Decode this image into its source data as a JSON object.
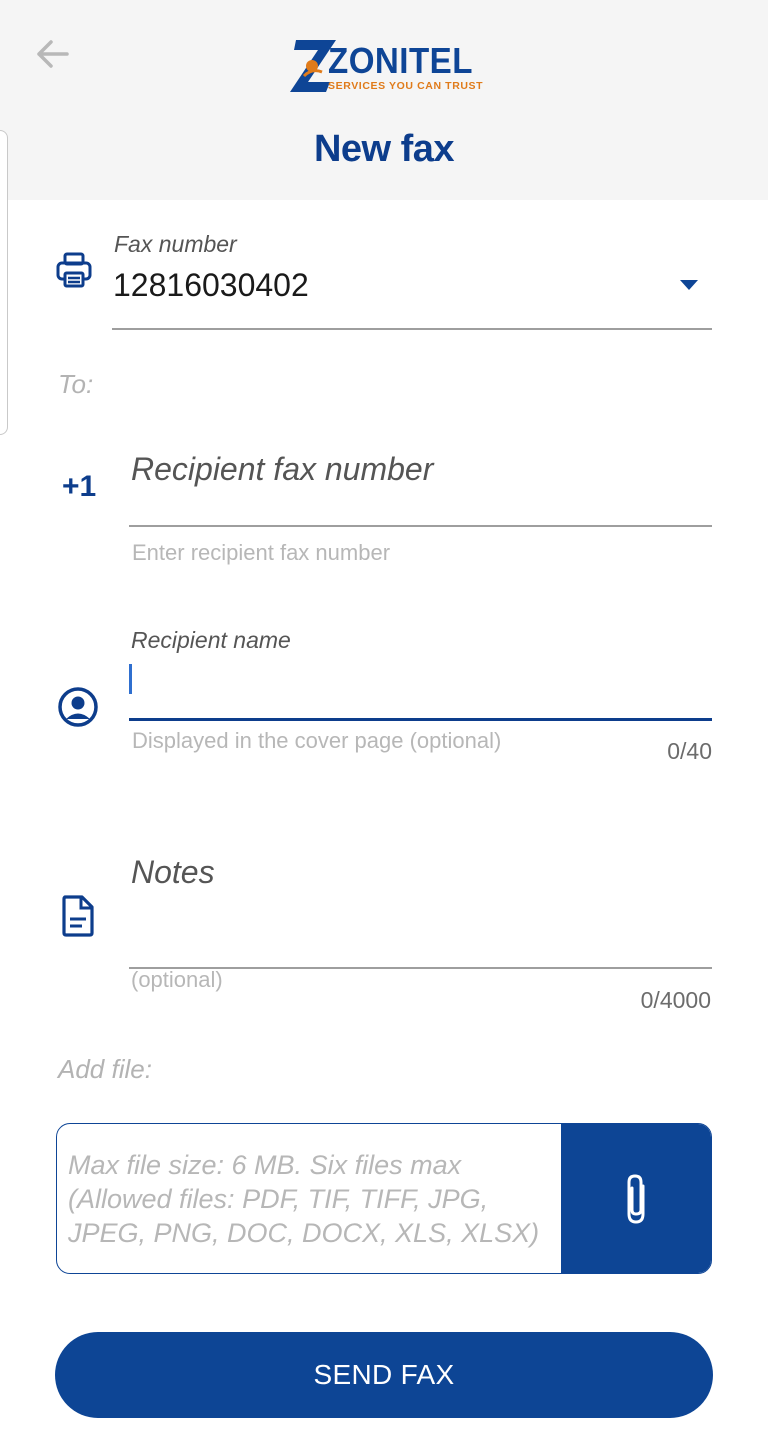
{
  "header": {
    "logo_text": "ZONITEL",
    "logo_tagline": "SERVICES YOU CAN TRUST",
    "title": "New fax"
  },
  "fax_number": {
    "label": "Fax number",
    "value": "12816030402"
  },
  "to_label": "To:",
  "recipient_fax": {
    "country_code": "+1",
    "placeholder": "Recipient fax number",
    "helper": "Enter recipient fax number"
  },
  "recipient_name": {
    "label": "Recipient name",
    "value": "",
    "helper": "Displayed in the cover page (optional)",
    "counter": "0/40"
  },
  "notes": {
    "placeholder": "Notes",
    "helper": "(optional)",
    "counter": "0/4000"
  },
  "add_file": {
    "label": "Add file:",
    "line1": "Max file size: 6 MB. Six files max",
    "line2": "(Allowed files: PDF, TIF, TIFF, JPG,",
    "line3": "JPEG, PNG, DOC, DOCX, XLS, XLSX)"
  },
  "send_button": "SEND FAX",
  "colors": {
    "primary": "#0d4595",
    "accent": "#e07b1a",
    "header_bg": "#f5f5f5"
  },
  "icons": {
    "back": "arrow-left-icon",
    "fax": "printer-icon",
    "dropdown": "caret-down-icon",
    "user": "user-circle-icon",
    "notes": "document-icon",
    "attach": "paperclip-icon"
  }
}
